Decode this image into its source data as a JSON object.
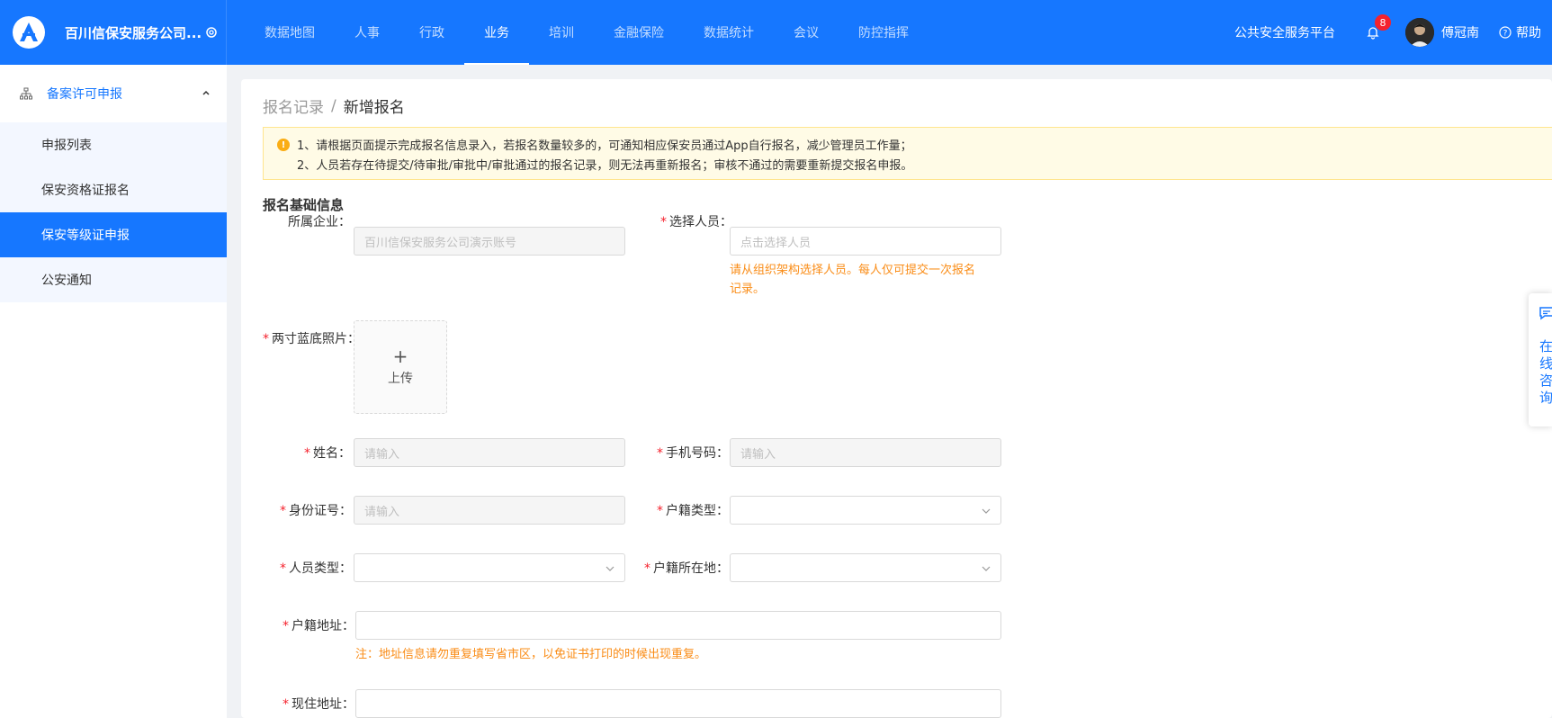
{
  "brand": {
    "name": "百川信保安服务公司..."
  },
  "nav": {
    "items": [
      "数据地图",
      "人事",
      "行政",
      "业务",
      "培训",
      "金融保险",
      "数据统计",
      "会议",
      "防控指挥"
    ],
    "active": "业务"
  },
  "header": {
    "platform_link": "公共安全服务平台",
    "notification_count": "8",
    "username": "傅冠南",
    "help": "帮助"
  },
  "sidebar": {
    "group": {
      "label": "备案许可申报",
      "expanded": true
    },
    "items": [
      {
        "label": "申报列表",
        "active": false
      },
      {
        "label": "保安资格证报名",
        "active": false
      },
      {
        "label": "保安等级证申报",
        "active": true
      },
      {
        "label": "公安通知",
        "active": false
      }
    ]
  },
  "breadcrumb": {
    "parent": "报名记录",
    "separator": "/",
    "current": "新增报名"
  },
  "alert": {
    "line1": "1、请根据页面提示完成报名信息录入，若报名数量较多的，可通知相应保安员通过App自行报名，减少管理员工作量；",
    "line2": "2、人员若存在待提交/待审批/审批中/审批通过的报名记录，则无法再重新报名；审核不通过的需要重新提交报名申报。"
  },
  "form": {
    "section_title": "报名基础信息",
    "required_mark": "*",
    "company": {
      "label": "所属企业：",
      "value": "百川信保安服务公司演示账号"
    },
    "select_person": {
      "label": "选择人员：",
      "placeholder": "点击选择人员",
      "hint_line1": "请从组织架构选择人员。每人仅可提交一次报名",
      "hint_line2": "记录。"
    },
    "photo": {
      "label": "两寸蓝底照片：",
      "upload_text": "上传",
      "upload_plus": "+"
    },
    "name": {
      "label": "姓名：",
      "placeholder": "请输入"
    },
    "phone": {
      "label": "手机号码：",
      "placeholder": "请输入"
    },
    "id_number": {
      "label": "身份证号：",
      "placeholder": "请输入"
    },
    "household_type": {
      "label": "户籍类型：",
      "value": ""
    },
    "person_type": {
      "label": "人员类型：",
      "value": ""
    },
    "household_location": {
      "label": "户籍所在地：",
      "value": ""
    },
    "household_address": {
      "label": "户籍地址：",
      "value": "",
      "note": "注：地址信息请勿重复填写省市区，以免证书打印的时候出现重复。"
    },
    "current_address": {
      "label": "现住地址：",
      "value": ""
    }
  },
  "float_widget": {
    "text": "在线咨询"
  },
  "colors": {
    "primary": "#1677ff",
    "warning": "#fa8c16",
    "required": "#f5222d",
    "alert_bg": "#fffbe6"
  }
}
